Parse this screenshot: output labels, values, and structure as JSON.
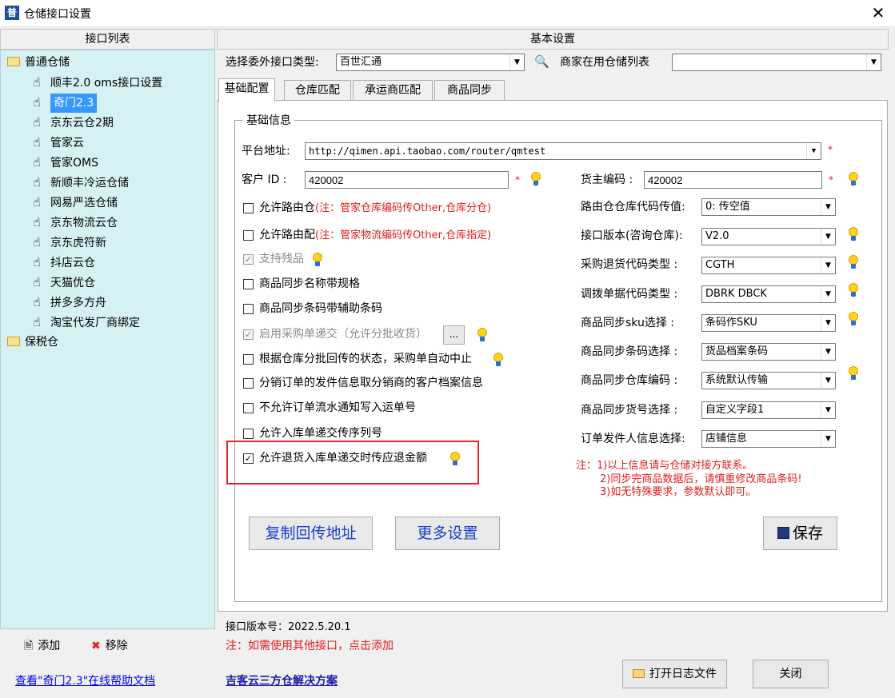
{
  "window": {
    "title": "仓储接口设置",
    "close_glyph": "✕"
  },
  "left": {
    "header": "接口列表",
    "tree": [
      {
        "label": "普通仓储",
        "type": "folder"
      },
      {
        "label": "顺丰2.0 oms接口设置",
        "type": "item"
      },
      {
        "label": "奇门2.3",
        "type": "item",
        "selected": true
      },
      {
        "label": "京东云仓2期",
        "type": "item"
      },
      {
        "label": "管家云",
        "type": "item"
      },
      {
        "label": "管家OMS",
        "type": "item"
      },
      {
        "label": "新顺丰冷运仓储",
        "type": "item"
      },
      {
        "label": "网易严选仓储",
        "type": "item"
      },
      {
        "label": "京东物流云仓",
        "type": "item"
      },
      {
        "label": "京东虎符新",
        "type": "item"
      },
      {
        "label": "抖店云仓",
        "type": "item"
      },
      {
        "label": "天猫优仓",
        "type": "item"
      },
      {
        "label": "拼多多方舟",
        "type": "item"
      },
      {
        "label": "淘宝代发厂商绑定",
        "type": "item"
      },
      {
        "label": "保税仓",
        "type": "folder"
      }
    ],
    "add_label": "添加",
    "remove_label": "移除",
    "help_link": "查看\"奇门2.3\"在线帮助文档"
  },
  "right": {
    "header": "基本设置",
    "type_label": "选择委外接口类型:",
    "type_value": "百世汇通",
    "warehouse_list_label": "商家在用仓储列表",
    "warehouse_list_value": "",
    "tabs": [
      "基础配置",
      "仓库匹配",
      "承运商匹配",
      "商品同步"
    ],
    "group_title": "基础信息",
    "platform_label": "平台地址:",
    "platform_value": "http://qimen.api.taobao.com/router/qmtest",
    "customer_label": "客户 ID :",
    "customer_value": "420002",
    "owner_label": "货主编码 :",
    "owner_value": "420002",
    "required_mark": "*",
    "checks": [
      {
        "label": "允许路由仓",
        "note": "(注：管家仓库编码传Other,仓库分仓)",
        "checked": false,
        "enabled": true
      },
      {
        "label": "允许路由配",
        "note": "(注：管家物流编码传Other,仓库指定)",
        "checked": false,
        "enabled": true
      },
      {
        "label": "支持残品",
        "checked": true,
        "enabled": false
      },
      {
        "label": "商品同步名称带规格",
        "checked": false,
        "enabled": true
      },
      {
        "label": "商品同步条码带辅助条码",
        "checked": false,
        "enabled": true
      },
      {
        "label": "启用采购单递交（允许分批收货）",
        "checked": true,
        "enabled": false
      },
      {
        "label": "根据仓库分批回传的状态，采购单自动中止",
        "checked": false,
        "enabled": true
      },
      {
        "label": "分销订单的发件信息取分销商的客户档案信息",
        "checked": false,
        "enabled": true
      },
      {
        "label": "不允许订单流水通知写入运单号",
        "checked": false,
        "enabled": true
      },
      {
        "label": "允许入库单递交传序列号",
        "checked": false,
        "enabled": true
      },
      {
        "label": "允许退货入库单递交时传应退金额",
        "checked": true,
        "enabled": true
      }
    ],
    "ellipsis_label": "...",
    "fields": [
      {
        "label": "路由仓仓库代码传值:",
        "value": "0: 传空值"
      },
      {
        "label": "接口版本(咨询仓库):",
        "value": "V2.0"
      },
      {
        "label": "采购退货代码类型  :",
        "value": "CGTH"
      },
      {
        "label": "调拨单据代码类型  :",
        "value": "DBRK  DBCK"
      },
      {
        "label": "商品同步sku选择  :",
        "value": "条码作SKU"
      },
      {
        "label": "商品同步条码选择  :",
        "value": "货品档案条码"
      },
      {
        "label": "商品同步仓库编码  :",
        "value": "系统默认传输"
      },
      {
        "label": "商品同步货号选择  :",
        "value": "自定义字段1"
      },
      {
        "label": "订单发件人信息选择:",
        "value": "店铺信息"
      }
    ],
    "notes": [
      "注：1)以上信息请与仓储对接方联系。",
      "2)同步完商品数据后，请慎重修改商品条码!",
      "3)如无特殊要求，参数默认即可。"
    ],
    "copy_button": "复制回传地址",
    "more_button": "更多设置",
    "save_button": "保存",
    "version_text": "接口版本号：2022.5.20.1",
    "add_note": "注：如需使用其他接口，点击添加",
    "solution_link": "吉客云三方仓解决方案",
    "log_button": "打开日志文件",
    "close_button": "关闭"
  }
}
